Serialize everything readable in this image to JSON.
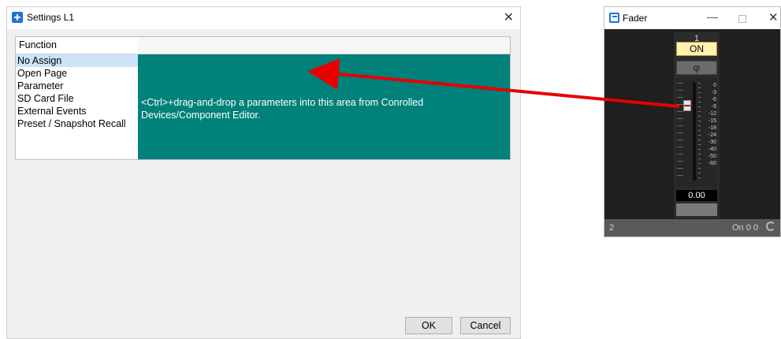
{
  "dialog": {
    "title": "Settings L1",
    "function_header": "Function",
    "functions": [
      {
        "label": "No Assign",
        "selected": true
      },
      {
        "label": "Open Page",
        "selected": false
      },
      {
        "label": "Parameter",
        "selected": false
      },
      {
        "label": "SD Card File",
        "selected": false
      },
      {
        "label": "External Events",
        "selected": false
      },
      {
        "label": "Preset / Snapshot Recall",
        "selected": false
      }
    ],
    "drop_hint": "<Ctrl>+drag-and-drop a parameters into this area from Conrolled Devices/Component Editor.",
    "ok_label": "OK",
    "cancel_label": "Cancel",
    "drop_area_color": "#00817a"
  },
  "fader": {
    "title": "Fader",
    "channel_number": "1",
    "on_label": "ON",
    "phase_symbol": "φ",
    "scale": [
      "0",
      "-3",
      "-6",
      "-9",
      "-12",
      "-15",
      "-18",
      "-24",
      "-30",
      "-40",
      "-50",
      "-60"
    ],
    "value": "0.00",
    "footer_left": "2",
    "footer_right": "On 0 0"
  },
  "icons": {
    "close": "close-icon",
    "minimize": "minimize-icon",
    "maximize": "maximize-icon",
    "sync": "sync-icon"
  }
}
